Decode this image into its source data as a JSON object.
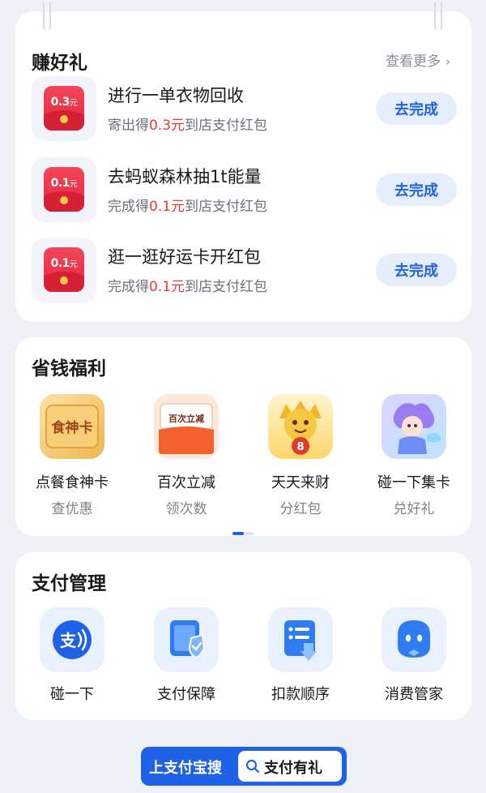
{
  "earn_gifts": {
    "title": "赚好礼",
    "more_label": "查看更多",
    "tasks": [
      {
        "amount": "0.3",
        "unit": "元",
        "title": "进行一单衣物回收",
        "sub_prefix": "寄出得",
        "sub_amount": "0.3元",
        "sub_suffix": "到店支付红包",
        "button": "去完成"
      },
      {
        "amount": "0.1",
        "unit": "元",
        "title": "去蚂蚁森林抽1t能量",
        "sub_prefix": "完成得",
        "sub_amount": "0.1元",
        "sub_suffix": "到店支付红包",
        "button": "去完成"
      },
      {
        "amount": "0.1",
        "unit": "元",
        "title": "逛一逛好运卡开红包",
        "sub_prefix": "完成得",
        "sub_amount": "0.1元",
        "sub_suffix": "到店支付红包",
        "button": "去完成"
      }
    ]
  },
  "savings": {
    "title": "省钱福利",
    "items": [
      {
        "name": "点餐食神卡",
        "sub": "查优惠",
        "badge": "食神卡"
      },
      {
        "name": "百次立减",
        "sub": "领次数",
        "badge": "百次立减"
      },
      {
        "name": "天天来财",
        "sub": "分红包",
        "badge": "8"
      },
      {
        "name": "碰一下集卡",
        "sub": "兑好礼"
      }
    ],
    "page_index": 1,
    "page_count": 2
  },
  "payment": {
    "title": "支付管理",
    "items": [
      {
        "label": "碰一下",
        "icon": "tap-pay-icon",
        "glyph": "支"
      },
      {
        "label": "支付保障",
        "icon": "shield-check-icon"
      },
      {
        "label": "扣款顺序",
        "icon": "deduction-order-icon"
      },
      {
        "label": "消费管家",
        "icon": "butler-icon"
      }
    ]
  },
  "search": {
    "lead": "上支付宝搜",
    "query": "支付有礼"
  },
  "colors": {
    "accent": "#1f62e8",
    "highlight": "#ee3a2c",
    "page_bg": "#eef1f8"
  }
}
